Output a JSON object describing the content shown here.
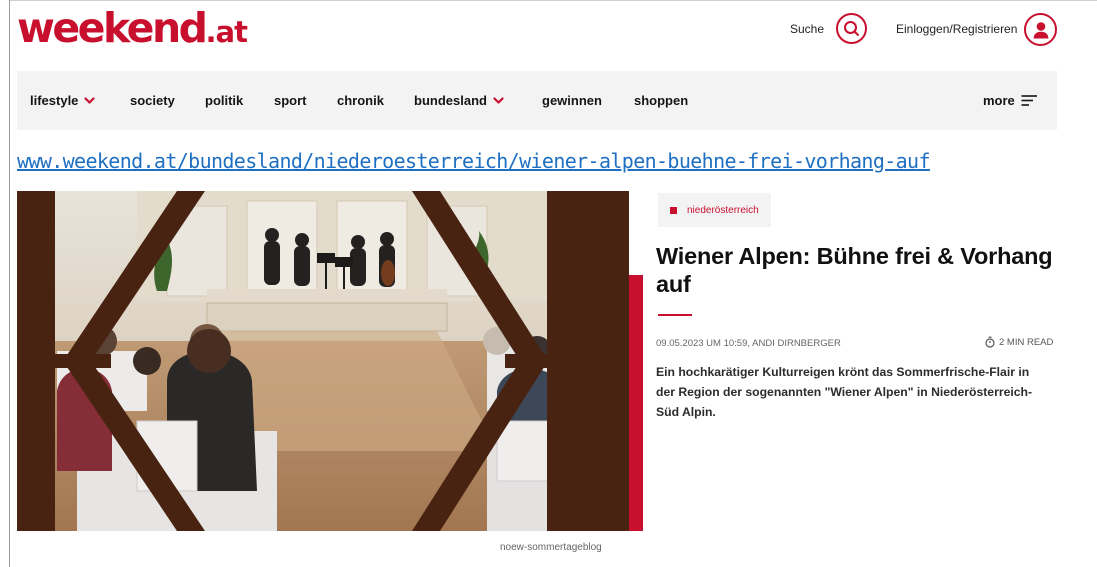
{
  "header": {
    "logo_main": "weekend",
    "logo_tld": ".at",
    "search_label": "Suche",
    "login_label": "Einloggen/Registrieren",
    "icons": {
      "search": "search-icon",
      "user": "user-icon"
    }
  },
  "nav": {
    "items": [
      {
        "label": "lifestyle",
        "dropdown": true
      },
      {
        "label": "society",
        "dropdown": false
      },
      {
        "label": "politik",
        "dropdown": false
      },
      {
        "label": "sport",
        "dropdown": false
      },
      {
        "label": "chronik",
        "dropdown": false
      },
      {
        "label": "bundesland",
        "dropdown": true
      },
      {
        "label": "gewinnen",
        "dropdown": false
      },
      {
        "label": "shoppen",
        "dropdown": false
      }
    ],
    "more_label": "more"
  },
  "url": "www.weekend.at/bundesland/niederoesterreich/wiener-alpen-buehne-frei-vorhang-auf",
  "article": {
    "tag": "niederösterreich",
    "headline": "Wiener Alpen: Bühne frei & Vorhang auf",
    "meta": "09.05.2023 UM 10:59, ANDI DIRNBERGER",
    "read_time": "2 MIN READ",
    "teaser": "Ein hochkarätiger Kulturreigen krönt das Sommerfrische-Flair in der Region der sogenannten \"Wiener Alpen\" in Niederösterreich-Süd Alpin.",
    "image_caption": "noew-sommertageblog",
    "image_alt": "Streichquartett im Festsaal"
  },
  "colors": {
    "brand": "#c8102e",
    "nav_bg": "#f3f3f3",
    "link": "#1f6fc2"
  }
}
